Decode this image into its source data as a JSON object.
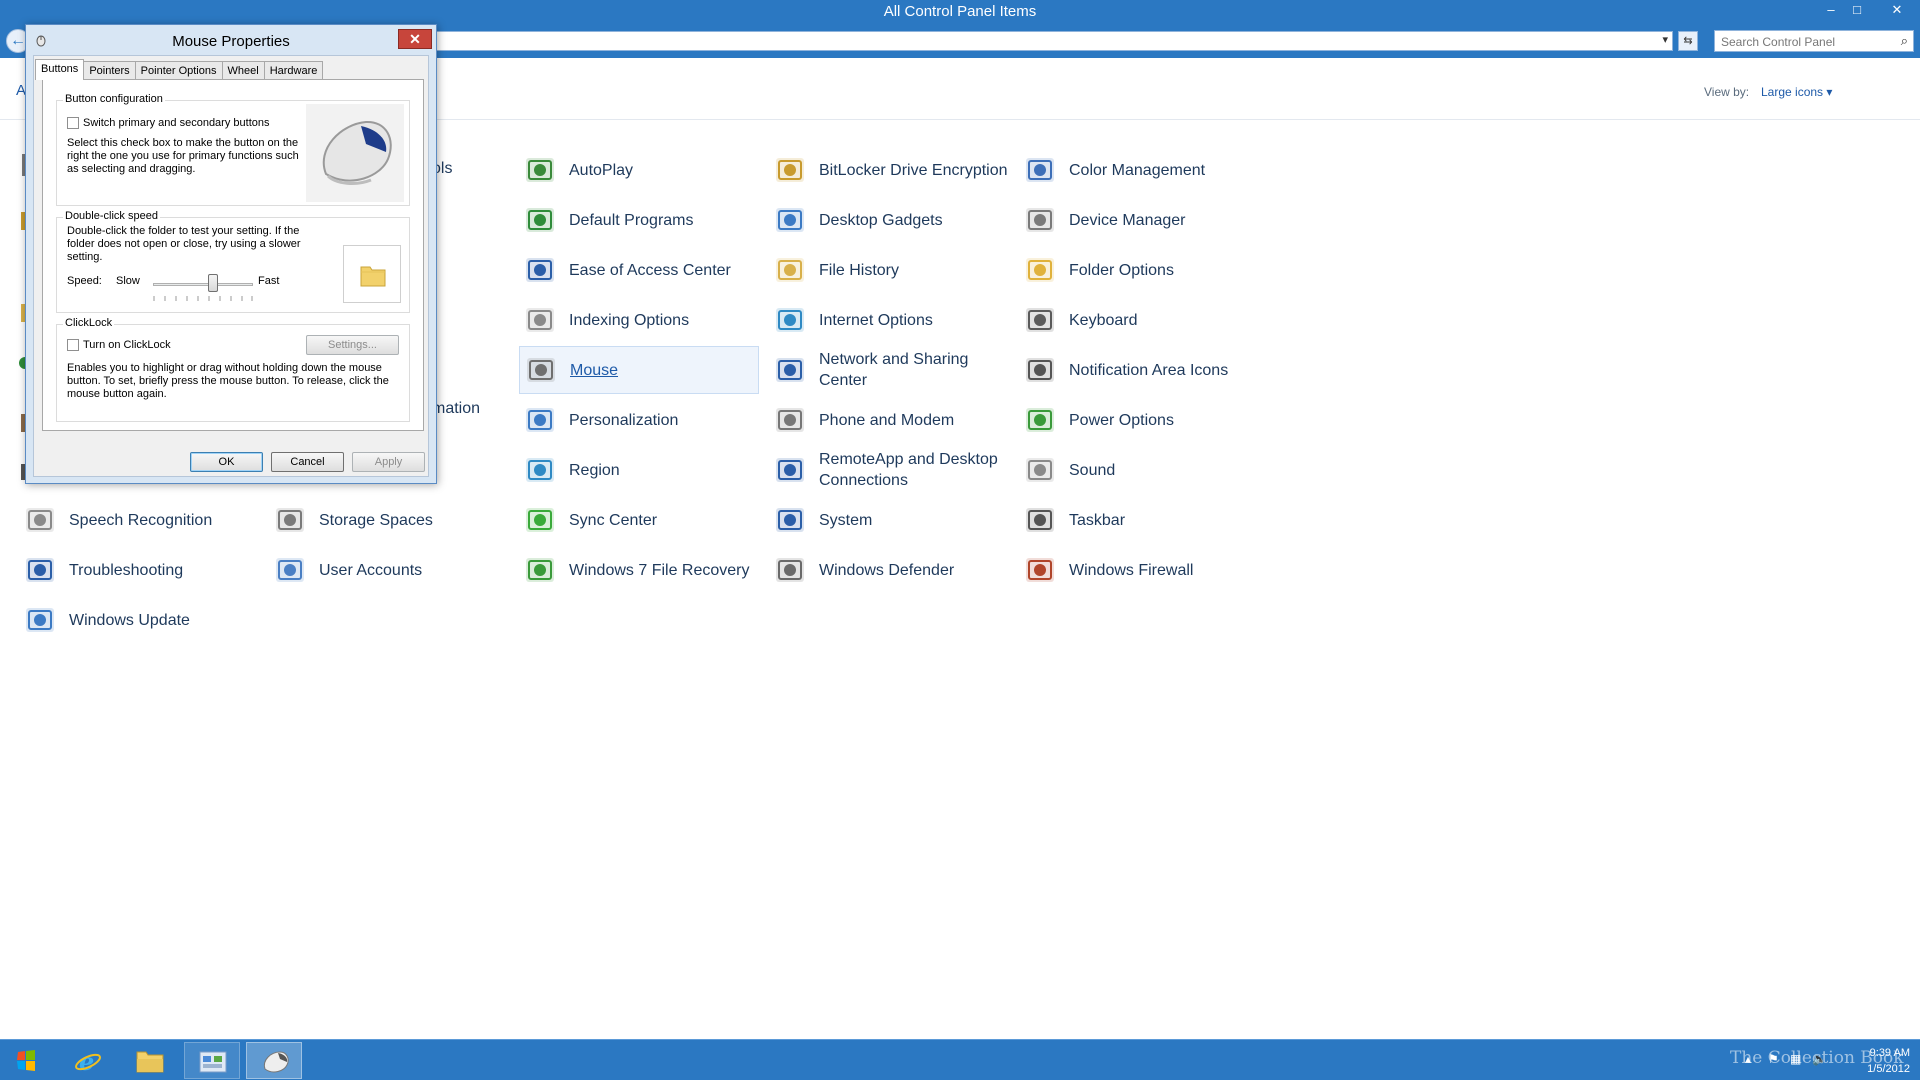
{
  "window": {
    "title": "All Control Panel Items"
  },
  "window_controls": {
    "minimize": "–",
    "maximize": "□",
    "close": "✕"
  },
  "address_bar": {
    "path": "",
    "refresh_icon": "⇆"
  },
  "search": {
    "placeholder": "Search Control Panel",
    "icon": "search-icon"
  },
  "header": {
    "partial_letter": "A",
    "view_by_label": "View by:",
    "view_by_value": "Large icons ▾"
  },
  "partial_items": [
    {
      "text": "ols"
    },
    {
      "text": "mation"
    }
  ],
  "items": [
    {
      "label": "AutoPlay",
      "icon": "autoplay-icon",
      "color": "#3a8a3a"
    },
    {
      "label": "BitLocker Drive Encryption",
      "icon": "bitlocker-icon",
      "color": "#c89b2e"
    },
    {
      "label": "Color Management",
      "icon": "color-management-icon",
      "color": "#3d6fb8"
    },
    {
      "label": "Default Programs",
      "icon": "default-programs-icon",
      "color": "#2f8c3a"
    },
    {
      "label": "Desktop Gadgets",
      "icon": "desktop-gadgets-icon",
      "color": "#3c7ac4"
    },
    {
      "label": "Device Manager",
      "icon": "device-manager-icon",
      "color": "#7a7a7a"
    },
    {
      "label": "Ease of Access Center",
      "icon": "ease-of-access-icon",
      "color": "#2b5fa8"
    },
    {
      "label": "File History",
      "icon": "file-history-icon",
      "color": "#d8b04a"
    },
    {
      "label": "Folder Options",
      "icon": "folder-options-icon",
      "color": "#e0b23c"
    },
    {
      "label": "Indexing Options",
      "icon": "indexing-options-icon",
      "color": "#8a8a8a"
    },
    {
      "label": "Internet Options",
      "icon": "internet-options-icon",
      "color": "#2f8ac4"
    },
    {
      "label": "Keyboard",
      "icon": "keyboard-icon",
      "color": "#5a5a5a"
    },
    {
      "label": "Mouse",
      "icon": "mouse-icon",
      "color": "#6f6f6f"
    },
    {
      "label": "Network and Sharing Center",
      "icon": "network-sharing-icon",
      "color": "#2b5fa8"
    },
    {
      "label": "Notification Area Icons",
      "icon": "notification-area-icon",
      "color": "#555555"
    },
    {
      "label": "Personalization",
      "icon": "personalization-icon",
      "color": "#3c7ac4"
    },
    {
      "label": "Phone and Modem",
      "icon": "phone-modem-icon",
      "color": "#777777"
    },
    {
      "label": "Power Options",
      "icon": "power-options-icon",
      "color": "#3a9a3a"
    },
    {
      "label": "Region",
      "icon": "region-icon",
      "color": "#2f8ac4"
    },
    {
      "label": "RemoteApp and Desktop Connections",
      "icon": "remoteapp-icon",
      "color": "#2b5fa8"
    },
    {
      "label": "Sound",
      "icon": "sound-icon",
      "color": "#8a8a8a"
    },
    {
      "label": "Speech Recognition",
      "icon": "speech-recognition-icon",
      "color": "#8a8a8a"
    },
    {
      "label": "Storage Spaces",
      "icon": "storage-spaces-icon",
      "color": "#7a7a7a"
    },
    {
      "label": "Sync Center",
      "icon": "sync-center-icon",
      "color": "#3aaa3a"
    },
    {
      "label": "System",
      "icon": "system-icon",
      "color": "#2b5fa8"
    },
    {
      "label": "Taskbar",
      "icon": "taskbar-icon",
      "color": "#555555"
    },
    {
      "label": "Troubleshooting",
      "icon": "troubleshooting-icon",
      "color": "#2b5fa8"
    },
    {
      "label": "User Accounts",
      "icon": "user-accounts-icon",
      "color": "#4a7fc4"
    },
    {
      "label": "Windows 7 File Recovery",
      "icon": "file-recovery-icon",
      "color": "#3a9a3a"
    },
    {
      "label": "Windows Defender",
      "icon": "windows-defender-icon",
      "color": "#6a6a6a"
    },
    {
      "label": "Windows Firewall",
      "icon": "windows-firewall-icon",
      "color": "#b0452a"
    },
    {
      "label": "Windows Update",
      "icon": "windows-update-icon",
      "color": "#3c7ac4"
    }
  ],
  "dialog": {
    "title": "Mouse Properties",
    "close": "✕",
    "tabs": [
      "Buttons",
      "Pointers",
      "Pointer Options",
      "Wheel",
      "Hardware"
    ],
    "button_config": {
      "title": "Button configuration",
      "checkbox_label": "Switch primary and secondary buttons",
      "description": "Select this check box to make the button on the right the one you use for primary functions such as selecting and dragging."
    },
    "double_click": {
      "title": "Double-click speed",
      "description": "Double-click the folder to test your setting. If the folder does not open or close, try using a slower setting.",
      "speed_label": "Speed:",
      "slow_label": "Slow",
      "fast_label": "Fast",
      "speed_value": 0.6
    },
    "clicklock": {
      "title": "ClickLock",
      "checkbox_label": "Turn on ClickLock",
      "settings_button": "Settings...",
      "description": "Enables you to highlight or drag without holding down the mouse button. To set, briefly press the mouse button. To release, click the mouse button again."
    },
    "ok": "OK",
    "cancel": "Cancel",
    "apply": "Apply"
  },
  "taskbar": {
    "time": "9:39 AM",
    "date": "1/5/2012",
    "watermark": "The Collection Book"
  }
}
